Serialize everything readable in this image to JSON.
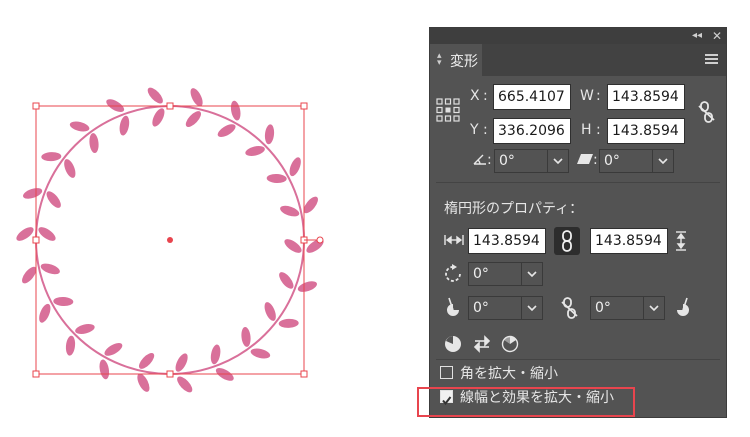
{
  "panel": {
    "tab_label": "変形",
    "x_label": "X",
    "x_value": "665.4107",
    "y_label": "Y",
    "y_value": "336.2096",
    "w_label": "W",
    "w_value": "143.8594",
    "h_label": "H",
    "h_value": "143.8594",
    "colon": ":",
    "rotate_value": "0°",
    "shear_value": "0°",
    "ellipse_section_title": "楕円形のプロパティ：",
    "ellipse_width": "143.8594",
    "ellipse_height": "143.8594",
    "ellipse_rotation": "0°",
    "pie_start": "0°",
    "pie_end": "0°",
    "scale_corners_label": "角を拡大・縮小",
    "scale_corners_checked": false,
    "scale_strokes_label": "線幅と効果を拡大・縮小",
    "scale_strokes_checked": true
  },
  "colors": {
    "panel_bg": "#535353",
    "selection": "#e8454e",
    "wreath": "#d9709a",
    "highlight": "#e8454e"
  }
}
